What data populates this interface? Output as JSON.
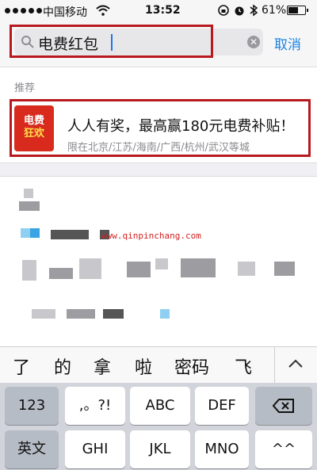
{
  "status_bar": {
    "carrier": "中国移动",
    "time": "13:52",
    "battery_percent": "61%",
    "icons": [
      "signal-dots-icon",
      "wifi-icon",
      "orientation-lock-icon",
      "alarm-icon",
      "bluetooth-icon",
      "battery-icon"
    ]
  },
  "search": {
    "query": "电费红包",
    "cancel_label": "取消",
    "accent_color": "#b8191e"
  },
  "recommend": {
    "section_label": "推荐",
    "logo_line1": "电费",
    "logo_line2": "狂欢",
    "title": "人人有奖，最高赢180元电费补贴！",
    "subtitle": "限在北京/江苏/海南/广西/杭州/武汉等城"
  },
  "watermark": "www.qinpinchang.com",
  "keyboard": {
    "candidates": [
      "了",
      "的",
      "拿",
      "啦",
      "密码",
      "飞"
    ],
    "row1": [
      "123",
      ",。?!",
      "ABC",
      "DEF"
    ],
    "row2": [
      "英文",
      "GHI",
      "JKL",
      "MNO",
      "^^"
    ],
    "link_color": "#1a82e0"
  }
}
